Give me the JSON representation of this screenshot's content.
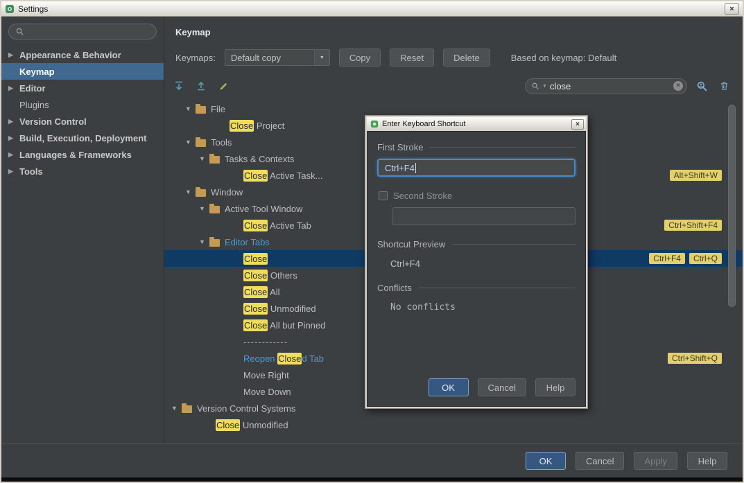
{
  "colors": {
    "highlight_yellow": "#f0dd5c",
    "shortcut_badge": "#e4cf6d",
    "tree_selection": "#0e3a64",
    "sidebar_selection": "#41688f",
    "accent_focus": "#4a88c7",
    "button_blue": "#365880",
    "link_blue": "#4d9bd5",
    "folder_color": "#c49a55"
  },
  "glyphs": {
    "expanded": "▼",
    "collapsed": "▶",
    "combo_arrow": "▼",
    "clear": "×",
    "close": "×"
  },
  "window": {
    "title": "Settings",
    "close": "×"
  },
  "sidebar": {
    "items": [
      {
        "label": "Appearance & Behavior",
        "arrow": true,
        "bold": true
      },
      {
        "label": "Keymap",
        "selected": true,
        "bold": true
      },
      {
        "label": "Editor",
        "arrow": true,
        "bold": true
      },
      {
        "label": "Plugins"
      },
      {
        "label": "Version Control",
        "arrow": true,
        "bold": true
      },
      {
        "label": "Build, Execution, Deployment",
        "arrow": true,
        "bold": true
      },
      {
        "label": "Languages & Frameworks",
        "arrow": true,
        "bold": true
      },
      {
        "label": "Tools",
        "arrow": true,
        "bold": true
      }
    ]
  },
  "main": {
    "header": "Keymap"
  },
  "keymap_bar": {
    "label": "Keymaps:",
    "value": "Default copy",
    "copy": "Copy",
    "reset": "Reset",
    "delete": "Delete",
    "based_on": "Based on keymap: Default"
  },
  "toolbar": {
    "search_value": "close"
  },
  "tree": {
    "rows": [
      {
        "type": "folder",
        "depth": 1,
        "label": "File"
      },
      {
        "type": "item",
        "depth": 2,
        "segments": [
          {
            "text": "Close",
            "hl": true
          },
          {
            "text": " Project"
          }
        ]
      },
      {
        "type": "folder",
        "depth": 1,
        "label": "Tools"
      },
      {
        "type": "folder",
        "depth": 2,
        "label": "Tasks & Contexts"
      },
      {
        "type": "item",
        "depth": 3,
        "segments": [
          {
            "text": "Close",
            "hl": true
          },
          {
            "text": " Active Task..."
          }
        ],
        "shortcuts": [
          "Alt+Shift+W"
        ]
      },
      {
        "type": "folder",
        "depth": 1,
        "label": "Window"
      },
      {
        "type": "folder",
        "depth": 2,
        "label": "Active Tool Window"
      },
      {
        "type": "item",
        "depth": 3,
        "segments": [
          {
            "text": "Close",
            "hl": true
          },
          {
            "text": " Active Tab"
          }
        ],
        "shortcuts": [
          "Ctrl+Shift+F4"
        ]
      },
      {
        "type": "folder",
        "depth": 2,
        "label": "Editor Tabs",
        "blue": true
      },
      {
        "type": "item",
        "depth": 3,
        "selected": true,
        "segments": [
          {
            "text": "Close",
            "hl": true
          }
        ],
        "shortcuts": [
          "Ctrl+F4",
          "Ctrl+Q"
        ]
      },
      {
        "type": "item",
        "depth": 3,
        "segments": [
          {
            "text": "Close",
            "hl": true
          },
          {
            "text": " Others"
          }
        ]
      },
      {
        "type": "item",
        "depth": 3,
        "segments": [
          {
            "text": "Close",
            "hl": true
          },
          {
            "text": " All"
          }
        ]
      },
      {
        "type": "item",
        "depth": 3,
        "segments": [
          {
            "text": "Close",
            "hl": true
          },
          {
            "text": " Unmodified"
          }
        ]
      },
      {
        "type": "item",
        "depth": 3,
        "segments": [
          {
            "text": "Close",
            "hl": true
          },
          {
            "text": " All but Pinned"
          }
        ]
      },
      {
        "type": "separator",
        "depth": 3,
        "label": "------------"
      },
      {
        "type": "item",
        "depth": 3,
        "segments": [
          {
            "text": "Reopen ",
            "blue": true
          },
          {
            "text": "Close",
            "hl": true
          },
          {
            "text": "d Tab",
            "blue": true
          }
        ],
        "shortcuts": [
          "Ctrl+Shift+Q"
        ]
      },
      {
        "type": "item",
        "depth": 3,
        "segments": [
          {
            "text": "Move Right"
          }
        ]
      },
      {
        "type": "item",
        "depth": 3,
        "segments": [
          {
            "text": "Move Down"
          }
        ]
      },
      {
        "type": "folder",
        "depth": 0,
        "label": "Version Control Systems"
      },
      {
        "type": "item",
        "depth": 1,
        "segments": [
          {
            "text": "Close",
            "hl": true
          },
          {
            "text": " Unmodified"
          }
        ]
      }
    ]
  },
  "dialog": {
    "title": "Enter Keyboard Shortcut",
    "close": "×",
    "first_stroke": {
      "label": "First Stroke",
      "value": "Ctrl+F4"
    },
    "second_stroke": {
      "label": "Second Stroke",
      "value": ""
    },
    "preview": {
      "label": "Shortcut Preview",
      "value": "Ctrl+F4"
    },
    "conflicts": {
      "label": "Conflicts",
      "value": "No conflicts"
    },
    "buttons": {
      "ok": "OK",
      "cancel": "Cancel",
      "help": "Help"
    }
  },
  "footer": {
    "ok": "OK",
    "cancel": "Cancel",
    "apply": "Apply",
    "help": "Help"
  }
}
